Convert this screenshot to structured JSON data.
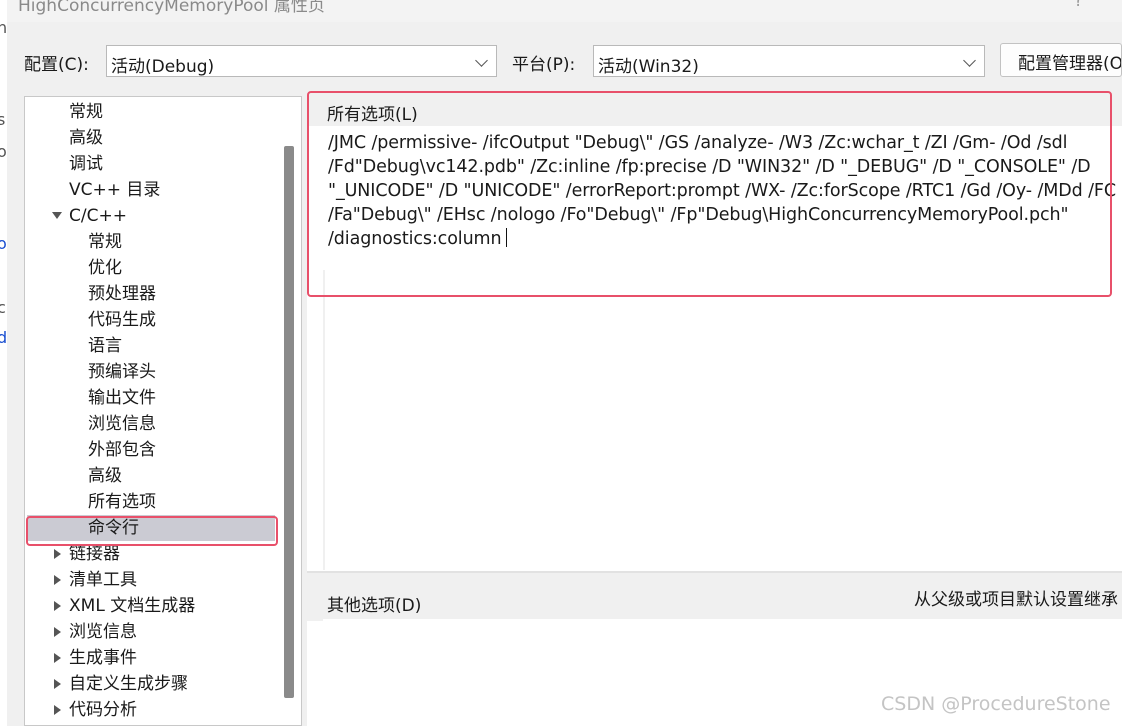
{
  "window": {
    "title": "HighConcurrencyMemoryPool 属性页",
    "help": "?"
  },
  "toolbar": {
    "config_label": "配置(C):",
    "config_value": "活动(Debug)",
    "platform_label": "平台(P):",
    "platform_value": "活动(Win32)",
    "config_manager_label": "配置管理器(O)..."
  },
  "left_edge_chars": [
    "n",
    "s",
    "o",
    "o",
    "c",
    "d"
  ],
  "tree": {
    "items": [
      {
        "label": "常规",
        "level": 1,
        "expander": "none"
      },
      {
        "label": "高级",
        "level": 1,
        "expander": "none"
      },
      {
        "label": "调试",
        "level": 1,
        "expander": "none"
      },
      {
        "label": "VC++ 目录",
        "level": 1,
        "expander": "none"
      },
      {
        "label": "C/C++",
        "level": 1,
        "expander": "expanded"
      },
      {
        "label": "常规",
        "level": 2,
        "expander": "none"
      },
      {
        "label": "优化",
        "level": 2,
        "expander": "none"
      },
      {
        "label": "预处理器",
        "level": 2,
        "expander": "none"
      },
      {
        "label": "代码生成",
        "level": 2,
        "expander": "none"
      },
      {
        "label": "语言",
        "level": 2,
        "expander": "none"
      },
      {
        "label": "预编译头",
        "level": 2,
        "expander": "none"
      },
      {
        "label": "输出文件",
        "level": 2,
        "expander": "none"
      },
      {
        "label": "浏览信息",
        "level": 2,
        "expander": "none"
      },
      {
        "label": "外部包含",
        "level": 2,
        "expander": "none"
      },
      {
        "label": "高级",
        "level": 2,
        "expander": "none"
      },
      {
        "label": "所有选项",
        "level": 2,
        "expander": "none"
      },
      {
        "label": "命令行",
        "level": 2,
        "expander": "none",
        "selected": true
      },
      {
        "label": "链接器",
        "level": 1,
        "expander": "collapsed"
      },
      {
        "label": "清单工具",
        "level": 1,
        "expander": "collapsed"
      },
      {
        "label": "XML 文档生成器",
        "level": 1,
        "expander": "collapsed"
      },
      {
        "label": "浏览信息",
        "level": 1,
        "expander": "collapsed"
      },
      {
        "label": "生成事件",
        "level": 1,
        "expander": "collapsed"
      },
      {
        "label": "自定义生成步骤",
        "level": 1,
        "expander": "collapsed"
      },
      {
        "label": "代码分析",
        "level": 1,
        "expander": "collapsed"
      }
    ]
  },
  "all_options": {
    "title": "所有选项(L)",
    "command_line": "/JMC /permissive- /ifcOutput \"Debug\\\" /GS /analyze- /W3 /Zc:wchar_t /ZI /Gm- /Od /sdl /Fd\"Debug\\vc142.pdb\" /Zc:inline /fp:precise /D \"WIN32\" /D \"_DEBUG\" /D \"_CONSOLE\" /D \"_UNICODE\" /D \"UNICODE\" /errorReport:prompt /WX- /Zc:forScope /RTC1 /Gd /Oy- /MDd /FC /Fa\"Debug\\\" /EHsc /nologo /Fo\"Debug\\\" /Fp\"Debug\\HighConcurrencyMemoryPool.pch\" /diagnostics:column"
  },
  "other_options": {
    "title": "其他选项(D)",
    "inherit_label": "从父级或项目默认设置继承",
    "value": ""
  },
  "watermark": "CSDN @ProcedureStone",
  "colors": {
    "highlight": "#e8506a",
    "selected_bg": "#cbcbd3"
  }
}
